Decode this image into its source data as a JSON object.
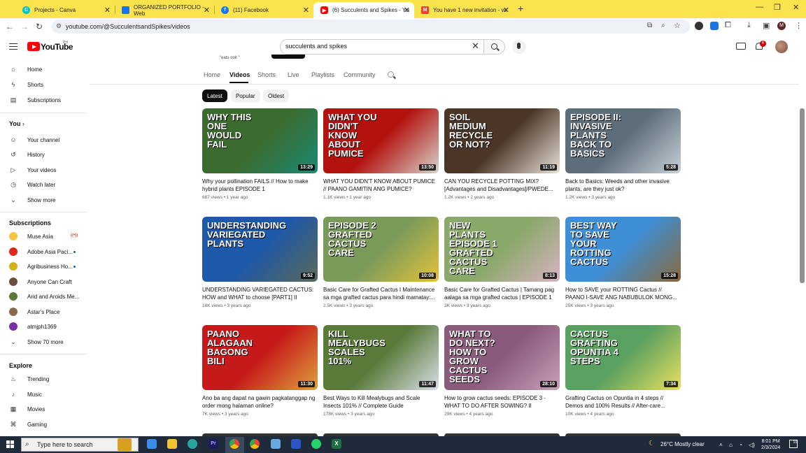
{
  "browser": {
    "tabs": [
      {
        "title": "Projects - Canva",
        "color": "#00c4cc"
      },
      {
        "title": "ORGANIZED PORTFOLIO - Web",
        "color": "#1a73e8"
      },
      {
        "title": "(11) Facebook",
        "color": "#1877f2"
      },
      {
        "title": "(6) Succulents and Spikes - You",
        "color": "#ff0000"
      },
      {
        "title": "You have 1 new invitation - vah",
        "color": "#ea4335"
      }
    ],
    "url": "youtube.com/@SucculentsandSpikes/videos"
  },
  "header": {
    "logo_text": "YouTube",
    "country": "PH",
    "search_value": "succulents and spikes",
    "notification_count": "6"
  },
  "sidebar": {
    "main": [
      {
        "label": "Home",
        "icon": "home-icon"
      },
      {
        "label": "Shorts",
        "icon": "shorts-icon"
      },
      {
        "label": "Subscriptions",
        "icon": "subscriptions-icon"
      }
    ],
    "you_heading": "You",
    "you": [
      {
        "label": "Your channel",
        "icon": "channel-icon"
      },
      {
        "label": "History",
        "icon": "history-icon"
      },
      {
        "label": "Your videos",
        "icon": "your-videos-icon"
      },
      {
        "label": "Watch later",
        "icon": "watch-later-icon"
      },
      {
        "label": "Show more",
        "icon": "chevron-down-icon"
      }
    ],
    "subs_heading": "Subscriptions",
    "subs": [
      {
        "label": "Muse Asia",
        "color": "#f5c542",
        "badge": "live"
      },
      {
        "label": "Adobe Asia Paci...",
        "color": "#e1251b",
        "badge": "dot"
      },
      {
        "label": "Agribusiness Ho...",
        "color": "#d4b21a",
        "badge": "dot"
      },
      {
        "label": "Anyone Can Craft",
        "color": "#6b4f3a",
        "badge": ""
      },
      {
        "label": "Arid and Aroids Me...",
        "color": "#5b7a3a",
        "badge": ""
      },
      {
        "label": "Astar's Place",
        "color": "#8a6a4a",
        "badge": ""
      },
      {
        "label": "atmjph1369",
        "color": "#7b2fa1",
        "badge": ""
      },
      {
        "label": "Show 70 more",
        "color": "",
        "badge": ""
      }
    ],
    "explore_heading": "Explore",
    "explore": [
      {
        "label": "Trending",
        "icon": "trending-icon"
      },
      {
        "label": "Music",
        "icon": "music-icon"
      },
      {
        "label": "Movies",
        "icon": "movies-icon"
      },
      {
        "label": "Gaming",
        "icon": "gaming-icon"
      }
    ]
  },
  "channel": {
    "top_fragment": "\"eats ooit \"",
    "tabs": [
      "Home",
      "Videos",
      "Shorts",
      "Live",
      "Playlists",
      "Community"
    ],
    "chips": [
      "Latest",
      "Popular",
      "Oldest"
    ]
  },
  "videos": [
    {
      "title": "Why your pollination FAILS // How to make hybrid plants EPISODE 1",
      "meta": "687 views • 1 year ago",
      "duration": "13:29",
      "thumb_text": "WHY THIS ONE WOULD FAIL",
      "bg": "#3b6b2e",
      "bg2": "#1d8a74"
    },
    {
      "title": "WHAT YOU DIDN'T KNOW ABOUT PUMICE // PAANO GAMITIN ANG PUMICE?",
      "meta": "1.1K views • 1 year ago",
      "duration": "13:50",
      "thumb_text": "WHAT YOU DIDN'T KNOW ABOUT PUMICE",
      "bg": "#b3120f",
      "bg2": "#d8d4cc"
    },
    {
      "title": "CAN YOU RECYCLE POTTING MIX? [Advantages and Disadvantages]/PWEDE...",
      "meta": "1.2K views • 2 years ago",
      "duration": "11:19",
      "thumb_text": "SOIL MEDIUM RECYCLE OR NOT?",
      "bg": "#4a3526",
      "bg2": "#e9e2d8"
    },
    {
      "title": "Back to Basics: Weeds and other invasive plants, are they just ok?",
      "meta": "1.2K views • 3 years ago",
      "duration": "5:28",
      "thumb_text": "EPISODE II: INVASIVE PLANTS BACK TO BASICS",
      "bg": "#5d6e7a",
      "bg2": "#c9d0d6"
    },
    {
      "title": "UNDERSTANDING VARIEGATED CACTUS: HOW and WHAT to choose [PART1] II PLUS...",
      "meta": "18K views • 3 years ago",
      "duration": "9:52",
      "thumb_text": "UNDERSTANDING VARIEGATED PLANTS",
      "bg": "#1e58a8",
      "bg2": "#5a6a5a"
    },
    {
      "title": "Basic Care for Grafted Cactus I Maintenance sa mga grafted cactus para hindi mamatay:...",
      "meta": "2.5K views • 3 years ago",
      "duration": "10:08",
      "thumb_text": "EPISODE 2 GRAFTED CACTUS CARE",
      "bg": "#7a9a5a",
      "bg2": "#e2c23c"
    },
    {
      "title": "Basic Care for Grafted Cactus | Tamang pag aalaga sa mga grafted cactus | EPISODE 1",
      "meta": "3K views • 3 years ago",
      "duration": "8:13",
      "thumb_text": "NEW PLANTS EPISODE 1 GRAFTED CACTUS CARE",
      "bg": "#8aa86a",
      "bg2": "#d8b3c4"
    },
    {
      "title": "How to SAVE your ROTTING Cactus // PAANO I-SAVE ANG NABUBULOK MONG...",
      "meta": "25K views • 3 years ago",
      "duration": "15:28",
      "thumb_text": "BEST WAY TO SAVE YOUR ROTTING CACTUS",
      "bg": "#3f8fd6",
      "bg2": "#8a6a3a"
    },
    {
      "title": "Ano ba ang dapat na gawin pagkatanggap ng order mong halaman online?",
      "meta": "7K views • 3 years ago",
      "duration": "11:30",
      "thumb_text": "PAANO ALAGAAN BAGONG BILI",
      "bg": "#c61a1a",
      "bg2": "#e0a040"
    },
    {
      "title": "Best Ways to Kill Mealybugs and Scale Insects 101% // Complete Guide",
      "meta": "178K views • 3 years ago",
      "duration": "11:47",
      "thumb_text": "KILL MEALYBUGS SCALES 101%",
      "bg": "#5a7a3a",
      "bg2": "#d8e0e6"
    },
    {
      "title": "How to grow cactus seeds: EPISODE 3 - WHAT TO DO AFTER SOWING? II COMPLE...",
      "meta": "29K views • 4 years ago",
      "duration": "28:10",
      "thumb_text": "WHAT TO DO NEXT? HOW TO GROW CACTUS SEEDS",
      "bg": "#8a5a7a",
      "bg2": "#c8a0b8"
    },
    {
      "title": "Grafting Cactus on Opuntia in 4 steps // Demos and 100% Results // After-care...",
      "meta": "10K views • 4 years ago",
      "duration": "7:34",
      "thumb_text": "CACTUS GRAFTING OPUNTIA 4 STEPS",
      "bg": "#5aa060",
      "bg2": "#e8e060"
    }
  ],
  "taskbar": {
    "search_placeholder": "Type here to search",
    "weather": "26°C  Mostly clear",
    "time": "8:01 PM",
    "date": "2/3/2024",
    "notifications": "10"
  }
}
